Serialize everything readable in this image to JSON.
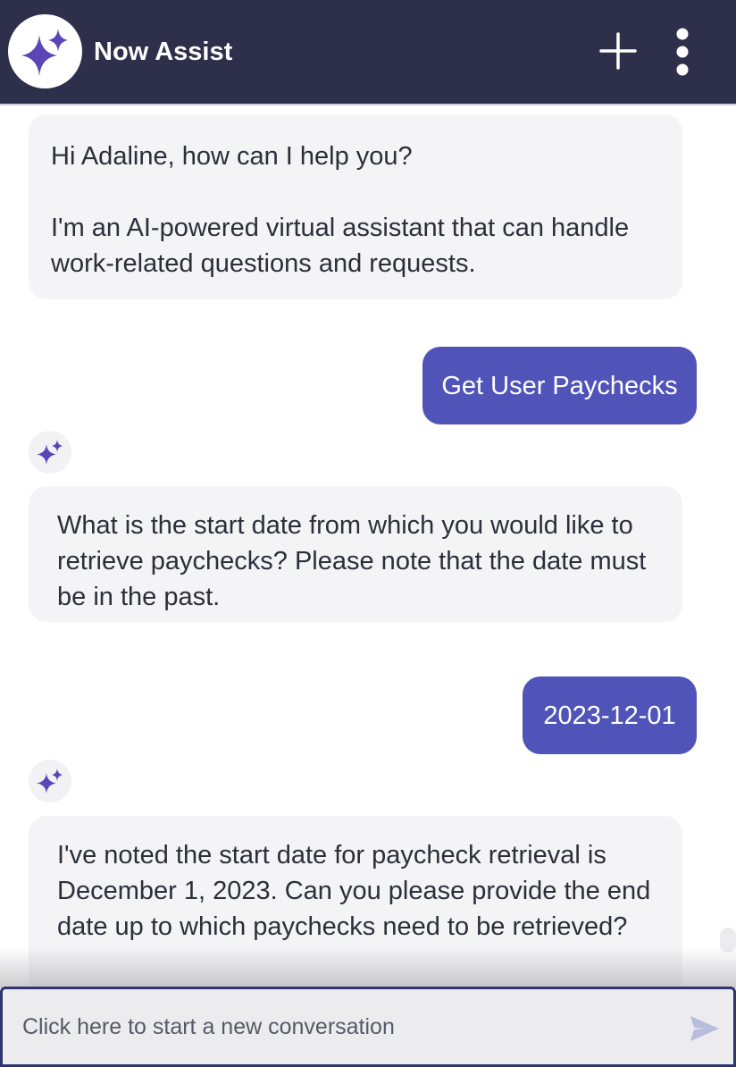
{
  "header": {
    "title": "Now Assist",
    "logo_icon": "sparkle-icon",
    "new_chat_icon": "plus-icon",
    "more_icon": "more-vertical-icon"
  },
  "messages": [
    {
      "role": "bot",
      "text": "Hi Adaline, how can I help you?\n\nI'm an AI-powered virtual assistant that can handle work-related questions and requests."
    },
    {
      "role": "user",
      "text": "Get User Paychecks"
    },
    {
      "role": "bot",
      "text": "What is the start date from which you would like to retrieve paychecks? Please note that the date must be in the past."
    },
    {
      "role": "user",
      "text": "2023-12-01"
    },
    {
      "role": "bot",
      "text": "I've noted the start date for paycheck retrieval is December 1, 2023. Can you please provide the end date up to which paychecks need to be retrieved?"
    }
  ],
  "composer": {
    "placeholder": "Click here to start a new conversation",
    "value": "",
    "send_icon": "send-icon"
  },
  "colors": {
    "header_bg": "#2e2f4a",
    "accent": "#5054b8",
    "bot_bubble": "#f4f4f6",
    "sparkle": "#5b46b8"
  }
}
